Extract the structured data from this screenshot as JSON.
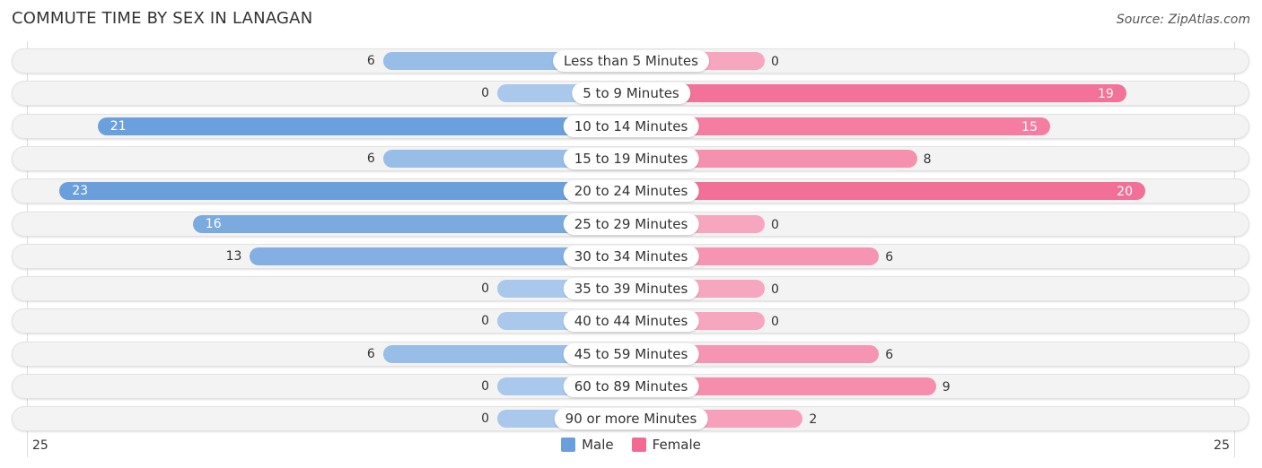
{
  "header": {
    "title": "COMMUTE TIME BY SEX IN LANAGAN",
    "source": "Source: ZipAtlas.com"
  },
  "colors": {
    "male": "#6a9fdb",
    "female": "#f26a93",
    "male_light": "#a9c8ec",
    "female_light": "#f7a6bf"
  },
  "chart_data": {
    "type": "bar",
    "orientation": "horizontal-diverging",
    "title": "COMMUTE TIME BY SEX IN LANAGAN",
    "categories": [
      "Less than 5 Minutes",
      "5 to 9 Minutes",
      "10 to 14 Minutes",
      "15 to 19 Minutes",
      "20 to 24 Minutes",
      "25 to 29 Minutes",
      "30 to 34 Minutes",
      "35 to 39 Minutes",
      "40 to 44 Minutes",
      "45 to 59 Minutes",
      "60 to 89 Minutes",
      "90 or more Minutes"
    ],
    "series": [
      {
        "name": "Male",
        "values": [
          6,
          0,
          21,
          6,
          23,
          16,
          13,
          0,
          0,
          6,
          0,
          0
        ]
      },
      {
        "name": "Female",
        "values": [
          0,
          19,
          15,
          8,
          20,
          0,
          6,
          0,
          0,
          6,
          9,
          2
        ]
      }
    ],
    "axis": {
      "left_label": "25",
      "right_label": "25",
      "range": [
        0,
        25
      ]
    },
    "legend": {
      "position": "bottom-center",
      "entries": [
        "Male",
        "Female"
      ]
    },
    "grid": false
  }
}
